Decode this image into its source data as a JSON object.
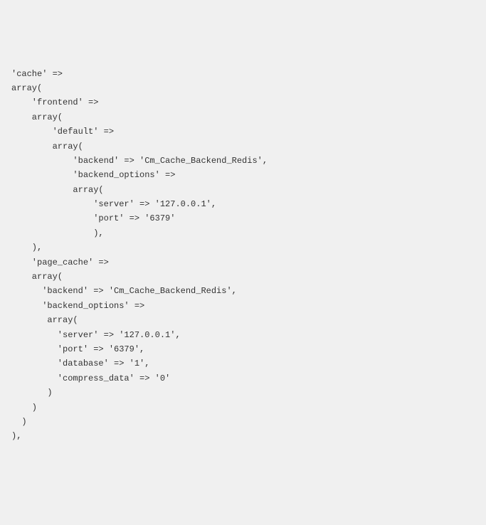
{
  "code": {
    "lines": [
      "'cache' =>",
      "array(",
      "    'frontend' =>",
      "    array(",
      "        'default' =>",
      "        array(",
      "            'backend' => 'Cm_Cache_Backend_Redis',",
      "            'backend_options' =>",
      "            array(",
      "                'server' => '127.0.0.1',",
      "                'port' => '6379'",
      "                ),",
      "    ),",
      "    'page_cache' =>",
      "    array(",
      "      'backend' => 'Cm_Cache_Backend_Redis',",
      "      'backend_options' =>",
      "       array(",
      "         'server' => '127.0.0.1',",
      "         'port' => '6379',",
      "         'database' => '1',",
      "         'compress_data' => '0'",
      "       )",
      "    )",
      "  )",
      "),"
    ]
  }
}
